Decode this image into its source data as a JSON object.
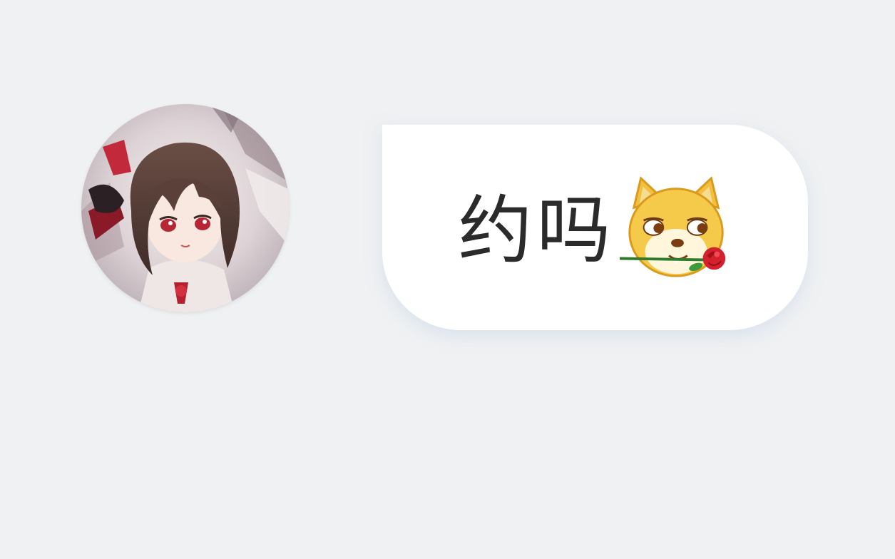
{
  "chat": {
    "message": {
      "text": "约吗",
      "emoji_icon": "doge-holding-rose-icon"
    },
    "avatar": {
      "icon": "anime-girl-avatar-icon"
    },
    "colors": {
      "background": "#eff1f3",
      "bubble": "#ffffff",
      "text": "#2b2b2b"
    }
  }
}
